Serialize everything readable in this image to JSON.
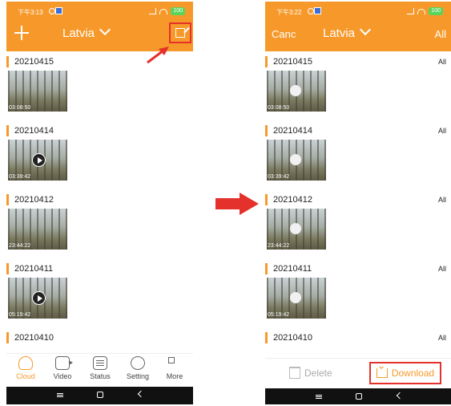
{
  "left_phone": {
    "status_time": "下午3:13",
    "battery": "100",
    "location": "Latvia",
    "recordings": [
      {
        "date": "20210415",
        "duration": "03:08:50",
        "playable": false
      },
      {
        "date": "20210414",
        "duration": "03:39:42",
        "playable": true
      },
      {
        "date": "20210412",
        "duration": "23:44:22",
        "playable": false
      },
      {
        "date": "20210411",
        "duration": "05:19:42",
        "playable": true
      },
      {
        "date": "20210410",
        "duration": "",
        "playable": false
      }
    ],
    "tabs": [
      {
        "label": "Cloud",
        "icon": "cloud-icon"
      },
      {
        "label": "Video",
        "icon": "video-icon"
      },
      {
        "label": "Status",
        "icon": "status-icon"
      },
      {
        "label": "Setting",
        "icon": "setting-icon"
      },
      {
        "label": "More",
        "icon": "more-icon"
      }
    ]
  },
  "right_phone": {
    "status_time": "下午3:22",
    "battery": "100",
    "cancel_label": "Canc",
    "location": "Latvia",
    "all_label": "All",
    "recordings": [
      {
        "date": "20210415",
        "duration": "03:08:50",
        "all": "All"
      },
      {
        "date": "20210414",
        "duration": "03:39:42",
        "all": "All"
      },
      {
        "date": "20210412",
        "duration": "23:44:22",
        "all": "All"
      },
      {
        "date": "20210411",
        "duration": "05:19:42",
        "all": "All"
      },
      {
        "date": "20210410",
        "duration": "",
        "all": "All"
      }
    ],
    "delete_label": "Delete",
    "download_label": "Download"
  },
  "colors": {
    "accent": "#f7992a",
    "highlight": "#e4312b"
  }
}
